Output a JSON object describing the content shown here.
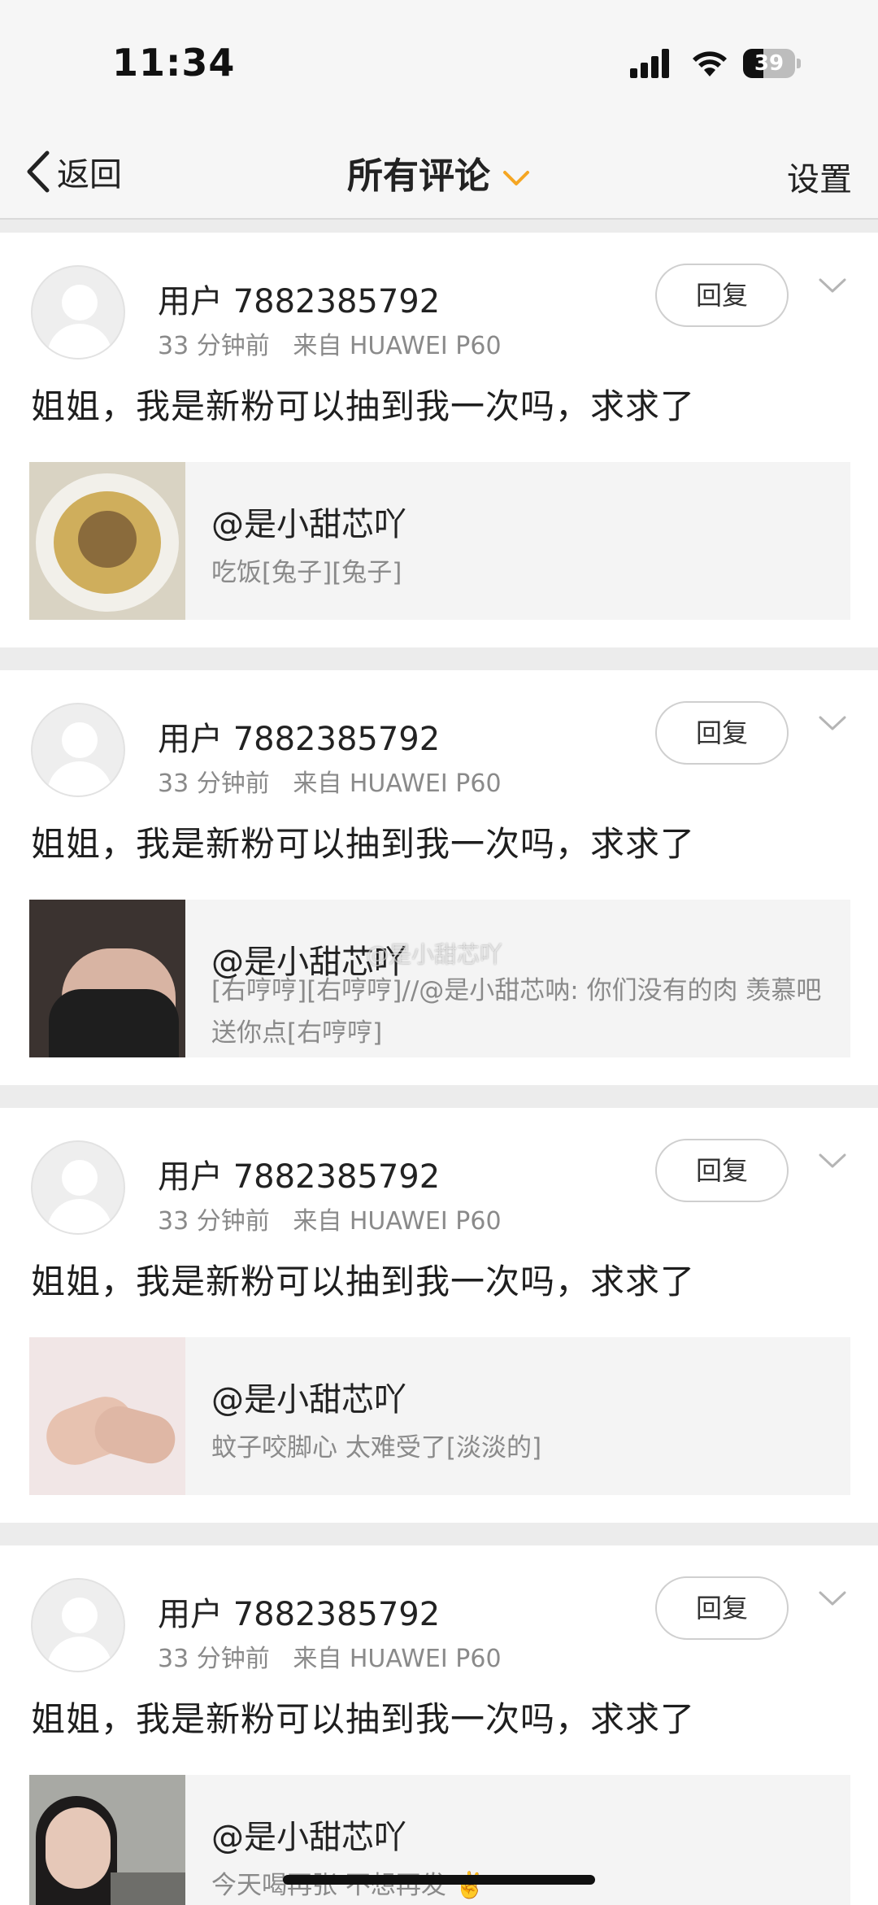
{
  "status_bar": {
    "time": "11:34",
    "battery": "39",
    "battery_level": 0.39
  },
  "nav": {
    "back_label": "返回",
    "title": "所有评论",
    "settings_label": "设置"
  },
  "comments": [
    {
      "username": "用户 7882385792",
      "time": "33 分钟前",
      "source": "来自 HUAWEI P60",
      "reply_label": "回复",
      "text": "姐姐，我是新粉可以抽到我一次吗，求求了",
      "quote_author": "@是小甜芯吖",
      "quote_text": "吃饭[兔子][兔子]"
    },
    {
      "username": "用户 7882385792",
      "time": "33 分钟前",
      "source": "来自 HUAWEI P60",
      "reply_label": "回复",
      "text": "姐姐，我是新粉可以抽到我一次吗，求求了",
      "quote_author": "@是小甜芯吖",
      "quote_text": "[右哼哼][右哼哼]//@是小甜芯呐: 你们没有的肉 羡慕吧 送你点[右哼哼]"
    },
    {
      "username": "用户 7882385792",
      "time": "33 分钟前",
      "source": "来自 HUAWEI P60",
      "reply_label": "回复",
      "text": "姐姐，我是新粉可以抽到我一次吗，求求了",
      "quote_author": "@是小甜芯吖",
      "quote_text": "蚊子咬脚心  太难受了[淡淡的]"
    },
    {
      "username": "用户 7882385792",
      "time": "33 分钟前",
      "source": "来自 HUAWEI P60",
      "reply_label": "回复",
      "text": "姐姐，我是新粉可以抽到我一次吗，求求了",
      "quote_author": "@是小甜芯吖",
      "quote_text": "今天喝再张 不想再发 ✌️"
    }
  ],
  "watermark": "@是小甜芯吖",
  "colors": {
    "accent": "#f5a623",
    "background": "#ececec",
    "card": "#ffffff"
  }
}
